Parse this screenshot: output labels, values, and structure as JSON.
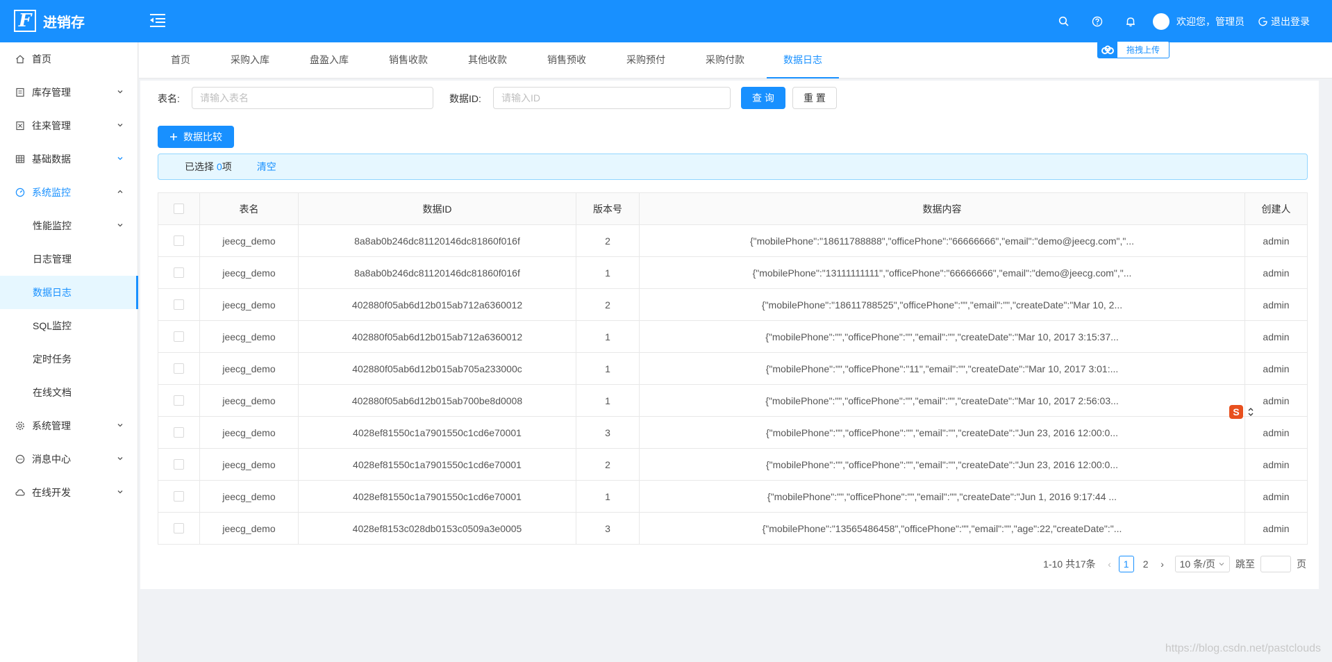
{
  "header": {
    "logo_letter": "F",
    "app_title": "进销存",
    "welcome": "欢迎您，管理员",
    "logout": "退出登录",
    "icons": [
      "search-icon",
      "question-circle-icon",
      "bell-icon"
    ]
  },
  "sidebar": {
    "items": [
      {
        "label": "首页",
        "icon": "home-icon"
      },
      {
        "label": "库存管理",
        "icon": "inventory-icon"
      },
      {
        "label": "往来管理",
        "icon": "contact-icon"
      },
      {
        "label": "基础数据",
        "icon": "table-icon"
      },
      {
        "label": "系统监控",
        "icon": "dashboard-icon"
      },
      {
        "label": "性能监控"
      },
      {
        "label": "日志管理"
      },
      {
        "label": "数据日志"
      },
      {
        "label": "SQL监控"
      },
      {
        "label": "定时任务"
      },
      {
        "label": "在线文档"
      },
      {
        "label": "系统管理",
        "icon": "gear-icon"
      },
      {
        "label": "消息中心",
        "icon": "message-icon"
      },
      {
        "label": "在线开发",
        "icon": "cloud-icon"
      }
    ]
  },
  "tabs": [
    "首页",
    "采购入库",
    "盘盈入库",
    "销售收款",
    "其他收款",
    "销售预收",
    "采购预付",
    "采购付款",
    "数据日志"
  ],
  "upload_float": {
    "label": "拖拽上传"
  },
  "search": {
    "table_label": "表名:",
    "table_placeholder": "请输入表名",
    "id_label": "数据ID:",
    "id_placeholder": "请输入ID",
    "query_btn": "查 询",
    "reset_btn": "重 置"
  },
  "toolbar": {
    "compare_btn": "数据比较"
  },
  "selection": {
    "prefix": "已选择",
    "count": "0",
    "suffix": "项",
    "clear": "清空"
  },
  "table": {
    "columns": [
      "表名",
      "数据ID",
      "版本号",
      "数据内容",
      "创建人"
    ],
    "rows": [
      [
        "jeecg_demo",
        "8a8ab0b246dc81120146dc81860f016f",
        "2",
        "{\"mobilePhone\":\"18611788888\",\"officePhone\":\"66666666\",\"email\":\"demo@jeecg.com\",\"...",
        "admin"
      ],
      [
        "jeecg_demo",
        "8a8ab0b246dc81120146dc81860f016f",
        "1",
        "{\"mobilePhone\":\"13111111111\",\"officePhone\":\"66666666\",\"email\":\"demo@jeecg.com\",\"...",
        "admin"
      ],
      [
        "jeecg_demo",
        "402880f05ab6d12b015ab712a6360012",
        "2",
        "{\"mobilePhone\":\"18611788525\",\"officePhone\":\"\",\"email\":\"\",\"createDate\":\"Mar 10, 2...",
        "admin"
      ],
      [
        "jeecg_demo",
        "402880f05ab6d12b015ab712a6360012",
        "1",
        "{\"mobilePhone\":\"\",\"officePhone\":\"\",\"email\":\"\",\"createDate\":\"Mar 10, 2017 3:15:37...",
        "admin"
      ],
      [
        "jeecg_demo",
        "402880f05ab6d12b015ab705a233000c",
        "1",
        "{\"mobilePhone\":\"\",\"officePhone\":\"11\",\"email\":\"\",\"createDate\":\"Mar 10, 2017 3:01:...",
        "admin"
      ],
      [
        "jeecg_demo",
        "402880f05ab6d12b015ab700be8d0008",
        "1",
        "{\"mobilePhone\":\"\",\"officePhone\":\"\",\"email\":\"\",\"createDate\":\"Mar 10, 2017 2:56:03...",
        "admin"
      ],
      [
        "jeecg_demo",
        "4028ef81550c1a7901550c1cd6e70001",
        "3",
        "{\"mobilePhone\":\"\",\"officePhone\":\"\",\"email\":\"\",\"createDate\":\"Jun 23, 2016 12:00:0...",
        "admin"
      ],
      [
        "jeecg_demo",
        "4028ef81550c1a7901550c1cd6e70001",
        "2",
        "{\"mobilePhone\":\"\",\"officePhone\":\"\",\"email\":\"\",\"createDate\":\"Jun 23, 2016 12:00:0...",
        "admin"
      ],
      [
        "jeecg_demo",
        "4028ef81550c1a7901550c1cd6e70001",
        "1",
        "{\"mobilePhone\":\"\",\"officePhone\":\"\",\"email\":\"\",\"createDate\":\"Jun 1, 2016 9:17:44 ...",
        "admin"
      ],
      [
        "jeecg_demo",
        "4028ef8153c028db0153c0509a3e0005",
        "3",
        "{\"mobilePhone\":\"13565486458\",\"officePhone\":\"\",\"email\":\"\",\"age\":22,\"createDate\":\"...",
        "admin"
      ]
    ]
  },
  "pagination": {
    "total": "1-10 共17条",
    "pages": [
      "1",
      "2"
    ],
    "page_size": "10 条/页",
    "jump_label": "跳至",
    "page_suffix": "页"
  },
  "float_widget": {
    "badge": "S"
  },
  "watermark": "https://blog.csdn.net/pastclouds",
  "colors": {
    "primary": "#1890ff",
    "alert_bg": "#e6f7ff",
    "active_bg": "#e6f7ff",
    "sidebar_bg": "#ffffff"
  }
}
